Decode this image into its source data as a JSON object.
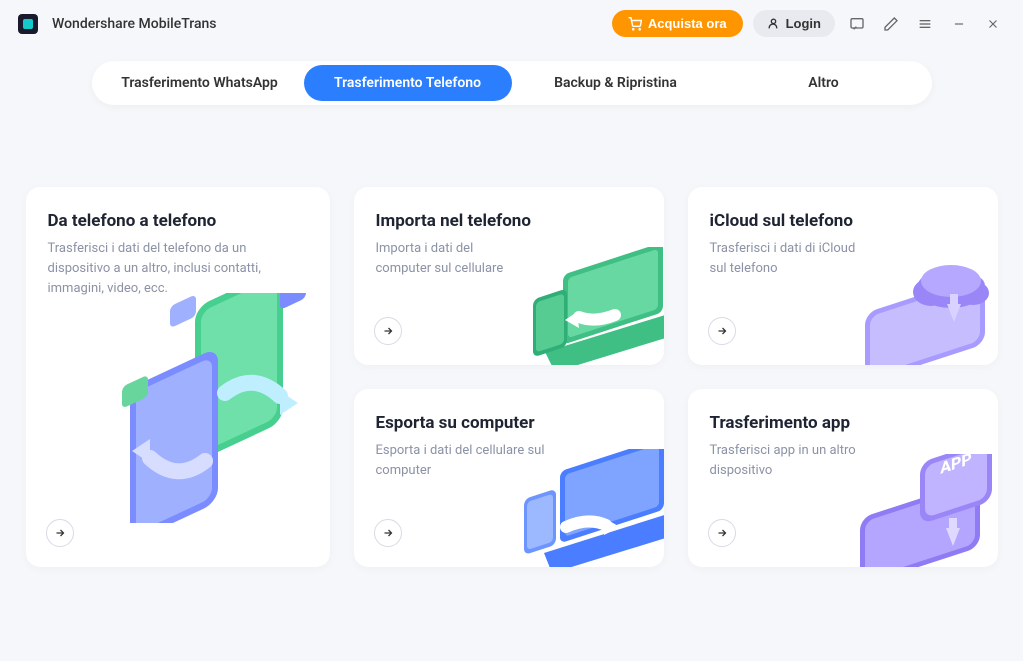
{
  "app": {
    "title": "Wondershare MobileTrans"
  },
  "titlebar": {
    "buy_label": "Acquista ora",
    "login_label": "Login"
  },
  "tabs": [
    {
      "label": "Trasferimento WhatsApp",
      "active": false
    },
    {
      "label": "Trasferimento Telefono",
      "active": true
    },
    {
      "label": "Backup & Ripristina",
      "active": false
    },
    {
      "label": "Altro",
      "active": false
    }
  ],
  "cards": {
    "phone_to_phone": {
      "title": "Da telefono a telefono",
      "desc": "Trasferisci i dati del telefono da un dispositivo a un altro, inclusi contatti, immagini, video, ecc."
    },
    "import_to_phone": {
      "title": "Importa nel telefono",
      "desc": "Importa i dati del computer sul cellulare"
    },
    "icloud_to_phone": {
      "title": "iCloud sul telefono",
      "desc": "Trasferisci i dati di iCloud sul telefono"
    },
    "export_to_computer": {
      "title": "Esporta su computer",
      "desc": "Esporta i dati del cellulare sul computer"
    },
    "app_transfer": {
      "title": "Trasferimento app",
      "desc": "Trasferisci app in un altro dispositivo"
    }
  }
}
